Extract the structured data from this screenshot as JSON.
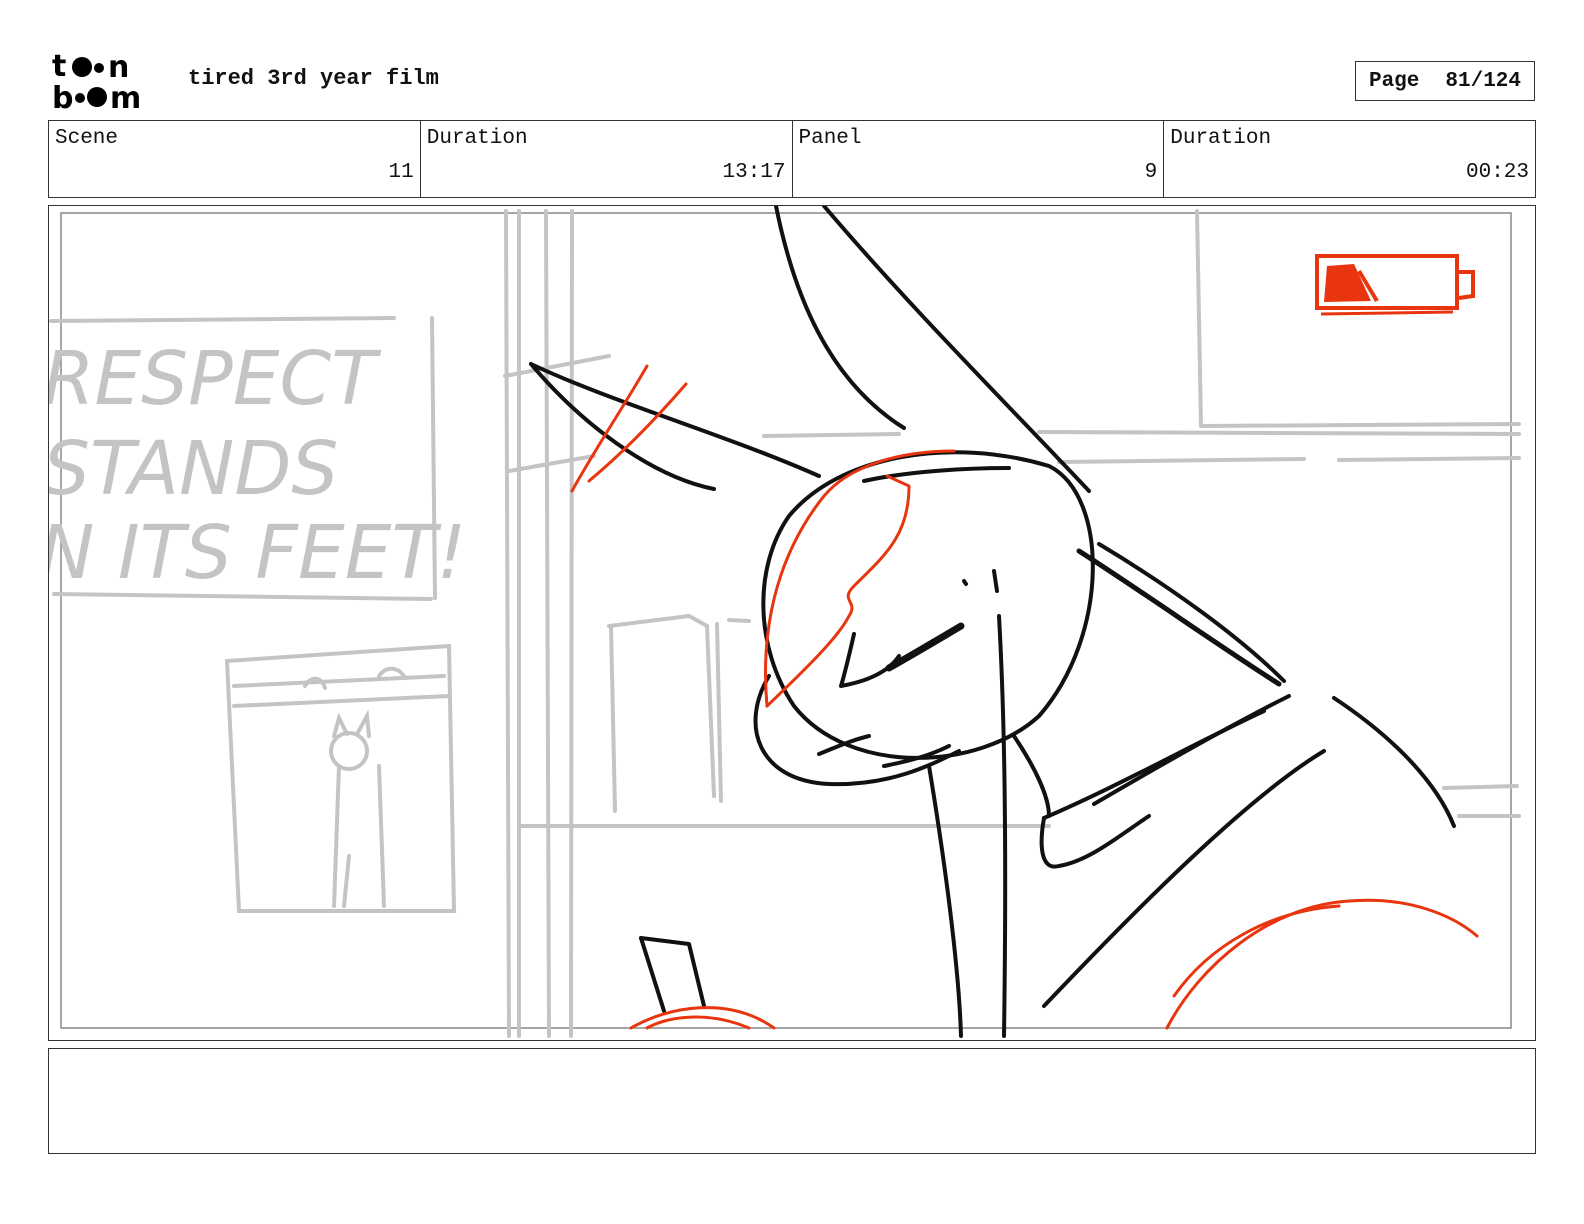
{
  "header": {
    "logo_text": "toonboom",
    "project_title": "tired 3rd year film",
    "page_label": "Page",
    "page_number": "81/124"
  },
  "info": {
    "scene_label": "Scene",
    "scene_value": "11",
    "scene_duration_label": "Duration",
    "scene_duration_value": "13:17",
    "panel_label": "Panel",
    "panel_value": "9",
    "panel_duration_label": "Duration",
    "panel_duration_value": "00:23"
  },
  "panel": {
    "poster_text_lines": [
      "RESPECT",
      "STANDS",
      "N ITS FEET!"
    ],
    "colors": {
      "sketch": "#111111",
      "accent": "#e8350f",
      "background_sketch": "#c8c8c8"
    }
  },
  "notes": {
    "text": ""
  }
}
